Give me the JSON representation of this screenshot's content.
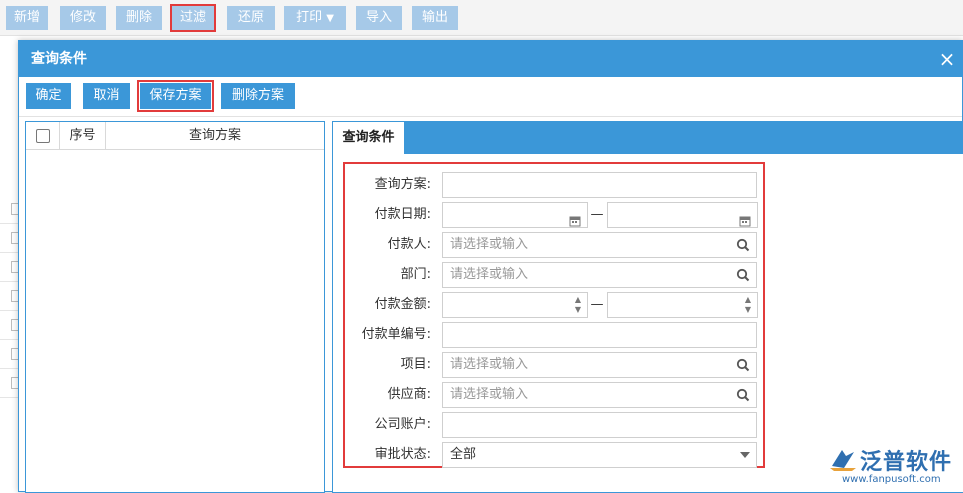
{
  "toolbar": {
    "buttons": [
      "新增",
      "修改",
      "删除",
      "过滤",
      "还原",
      "打印",
      "导入",
      "输出"
    ],
    "print_arrow": "▼"
  },
  "dialog": {
    "title": "查询条件",
    "close_glyph": "×",
    "buttons": [
      "确定",
      "取消",
      "保存方案",
      "删除方案"
    ]
  },
  "left_pane": {
    "columns": [
      "序号",
      "查询方案"
    ]
  },
  "right_pane": {
    "tab": "查询条件",
    "fields": [
      {
        "label": "查询方案:",
        "value": ""
      },
      {
        "label": "付款日期:",
        "from": "",
        "to": "",
        "separator": "—"
      },
      {
        "label": "付款人:",
        "placeholder": "请选择或输入"
      },
      {
        "label": "部门:",
        "placeholder": "请选择或输入"
      },
      {
        "label": "付款金额:",
        "from": "",
        "to": "",
        "separator": "—"
      },
      {
        "label": "付款单编号:",
        "value": ""
      },
      {
        "label": "项目:",
        "placeholder": "请选择或输入"
      },
      {
        "label": "供应商:",
        "placeholder": "请选择或输入"
      },
      {
        "label": "公司账户:",
        "value": ""
      },
      {
        "label": "审批状态:",
        "value": "全部"
      }
    ]
  },
  "logo": {
    "name": "泛普软件",
    "url": "www.fanpusoft.com"
  },
  "colors": {
    "accent": "#3b97d8",
    "toolbar_button": "#a6c9e8",
    "highlight": "#e23b3b",
    "brand": "#2f6fb0"
  },
  "icons": {
    "calendar": "calendar-icon",
    "search": "search-icon",
    "dropdown": "chevron-down-icon",
    "close": "close-icon"
  }
}
